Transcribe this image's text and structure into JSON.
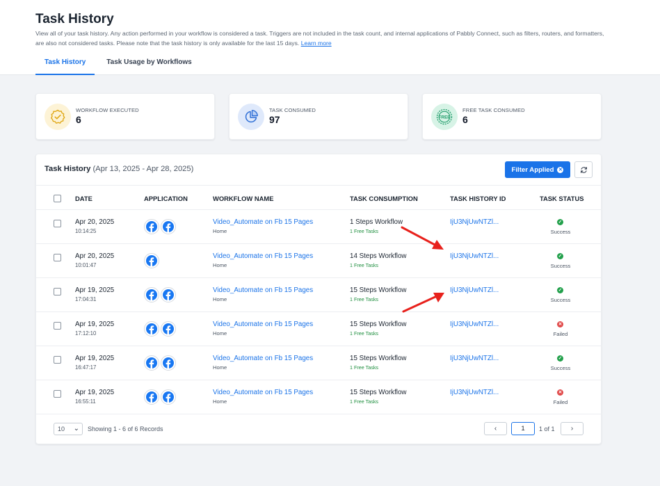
{
  "header": {
    "title": "Task History",
    "description": "View all of your task history. Any action performed in your workflow is considered a task. Triggers are not included in the task count, and internal applications of Pabbly Connect, such as filters, routers, and formatters, are also not considered tasks. Please note that the task history is only available for the last 15 days.",
    "learn_more": "Learn more",
    "tabs": [
      {
        "label": "Task History",
        "active": true
      },
      {
        "label": "Task Usage by Workflows",
        "active": false
      }
    ]
  },
  "stats": [
    {
      "label": "WORKFLOW EXECUTED",
      "value": "6",
      "icon": "badge-check-icon"
    },
    {
      "label": "TASK CONSUMED",
      "value": "97",
      "icon": "pie-chart-icon"
    },
    {
      "label": "FREE TASK CONSUMED",
      "value": "6",
      "icon": "free-icon"
    }
  ],
  "table": {
    "title": "Task History",
    "range": "(Apr 13, 2025 - Apr 28, 2025)",
    "filter_label": "Filter Applied",
    "columns": [
      "DATE",
      "APPLICATION",
      "WORKFLOW NAME",
      "TASK CONSUMPTION",
      "TASK HISTORY ID",
      "TASK STATUS"
    ],
    "rows": [
      {
        "date": "Apr 20, 2025",
        "time": "10:14:25",
        "apps": 2,
        "workflow": "Video_Automate on Fb 15 Pages",
        "folder": "Home",
        "steps": "1 Steps Workflow",
        "free": "1 Free Tasks",
        "id": "IjU3NjUwNTZl...",
        "status": "Success"
      },
      {
        "date": "Apr 20, 2025",
        "time": "10:01:47",
        "apps": 1,
        "workflow": "Video_Automate on Fb 15 Pages",
        "folder": "Home",
        "steps": "14 Steps Workflow",
        "free": "1 Free Tasks",
        "id": "IjU3NjUwNTZl...",
        "status": "Success"
      },
      {
        "date": "Apr 19, 2025",
        "time": "17:04:31",
        "apps": 2,
        "workflow": "Video_Automate on Fb 15 Pages",
        "folder": "Home",
        "steps": "15 Steps Workflow",
        "free": "1 Free Tasks",
        "id": "IjU3NjUwNTZl...",
        "status": "Success"
      },
      {
        "date": "Apr 19, 2025",
        "time": "17:12:10",
        "apps": 2,
        "workflow": "Video_Automate on Fb 15 Pages",
        "folder": "Home",
        "steps": "15 Steps Workflow",
        "free": "1 Free Tasks",
        "id": "IjU3NjUwNTZl...",
        "status": "Failed"
      },
      {
        "date": "Apr 19, 2025",
        "time": "16:47:17",
        "apps": 2,
        "workflow": "Video_Automate on Fb 15 Pages",
        "folder": "Home",
        "steps": "15 Steps Workflow",
        "free": "1 Free Tasks",
        "id": "IjU3NjUwNTZl...",
        "status": "Success"
      },
      {
        "date": "Apr 19, 2025",
        "time": "16:55:11",
        "apps": 2,
        "workflow": "Video_Automate on Fb 15 Pages",
        "folder": "Home",
        "steps": "15 Steps Workflow",
        "free": "1 Free Tasks",
        "id": "IjU3NjUwNTZl...",
        "status": "Failed"
      }
    ]
  },
  "pagination": {
    "per_page": "10",
    "info": "Showing 1 - 6 of 6 Records",
    "current": "1",
    "of": "1 of 1"
  },
  "colors": {
    "accent": "#1a73e8",
    "success": "#22a04b",
    "failed": "#e04848",
    "annotation": "#e8211c"
  }
}
